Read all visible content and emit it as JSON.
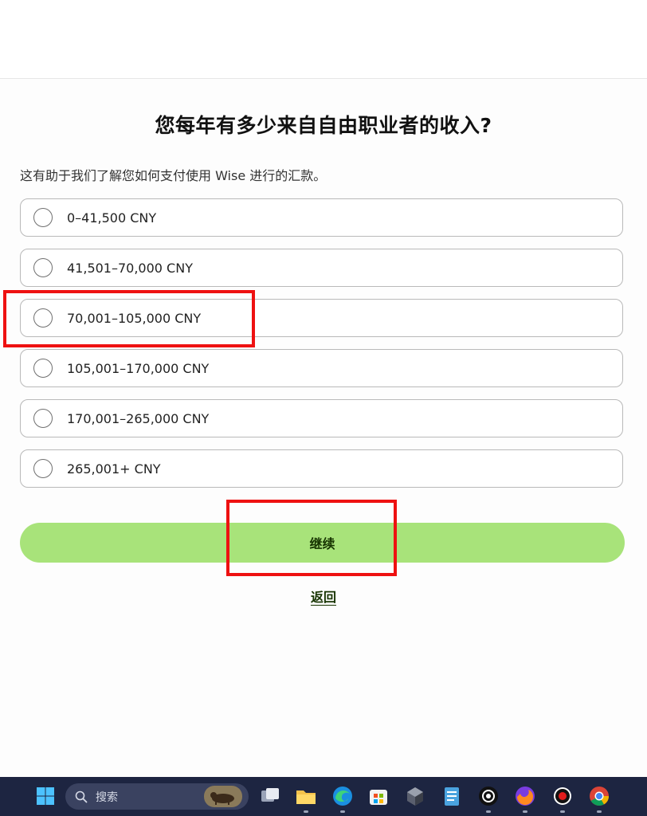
{
  "question": {
    "title": "您每年有多少来自自由职业者的收入?",
    "subtitle": "这有助于我们了解您如何支付使用 Wise 进行的汇款。"
  },
  "options": [
    {
      "label": "0–41,500 CNY",
      "selected": false
    },
    {
      "label": "41,501–70,000 CNY",
      "selected": false
    },
    {
      "label": "70,001–105,000 CNY",
      "selected": false
    },
    {
      "label": "105,001–170,000 CNY",
      "selected": false
    },
    {
      "label": "170,001–265,000 CNY",
      "selected": false
    },
    {
      "label": "265,001+ CNY",
      "selected": false
    }
  ],
  "actions": {
    "continue_label": "继续",
    "back_label": "返回"
  },
  "colors": {
    "accent": "#a8e37a",
    "accent_text": "#163300",
    "annotation": "#ee1111",
    "taskbar": "#1d2541"
  },
  "taskbar": {
    "search_placeholder": "搜索",
    "icons": [
      "windows-start-icon",
      "search-icon",
      "search-highlight-icon",
      "task-view-icon",
      "file-explorer-icon",
      "edge-icon",
      "microsoft-store-icon",
      "app-cube-icon",
      "notepad-icon",
      "camera-app-icon",
      "firefox-icon",
      "record-icon",
      "chrome-icon"
    ]
  }
}
